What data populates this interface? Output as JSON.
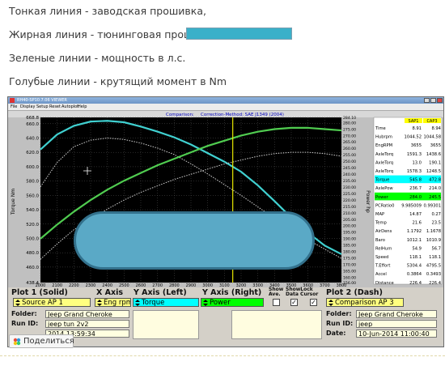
{
  "post": {
    "line1": "Тонкая линия - заводская прошивка,",
    "line2": "Жирная линия - тюнинговая прошивка от",
    "line3": "Зеленые линии - мощность в л.с.",
    "line4": "Голубые линии - крутящий момент в Nm"
  },
  "window": {
    "title": "RH40-SP10.7.06 VIEWER",
    "menu": [
      "File",
      "Display",
      "Setup",
      "Reset",
      "Autoplot",
      "Help"
    ]
  },
  "chart_data": {
    "type": "line",
    "header_left": "Comparison:",
    "header_right": "Correction-Method: SAE J1349 (2004)",
    "ylabel_left": "Torque Nm",
    "ylabel_right": "Power hp",
    "xlim": [
      2000,
      3800
    ],
    "ylim_left": [
      438.4,
      668.8
    ],
    "ylim_right": [
      156.0,
      284.1
    ],
    "x_ticks": [
      "2000",
      "2100",
      "2200",
      "2300",
      "2400",
      "2500",
      "2600",
      "2700",
      "2800",
      "2900",
      "3000",
      "3100",
      "3200",
      "3300",
      "3400",
      "3500",
      "3600",
      "3700",
      "3800"
    ],
    "y_left_ticks": [
      "668.8",
      "660.0",
      "640.0",
      "620.0",
      "600.0",
      "580.0",
      "560.0",
      "540.0",
      "520.0",
      "500.0",
      "480.0",
      "460.0",
      "438.4"
    ],
    "y_right_ticks": [
      "284.10",
      "280.00",
      "275.00",
      "270.00",
      "265.00",
      "260.00",
      "255.00",
      "250.00",
      "245.00",
      "240.00",
      "235.00",
      "230.00",
      "225.00",
      "220.00",
      "215.00",
      "210.00",
      "205.00",
      "200.00",
      "195.00",
      "190.00",
      "185.00",
      "180.00",
      "175.00",
      "170.00",
      "165.00",
      "160.00",
      "156.00"
    ],
    "cursor_x": 3150,
    "series": [
      {
        "axis": "left",
        "color": "#40d0d0",
        "width": 2.2,
        "x": [
          2000,
          2100,
          2200,
          2300,
          2400,
          2500,
          2600,
          2700,
          2800,
          2900,
          3000,
          3100,
          3200,
          3300,
          3400,
          3500,
          3600,
          3700,
          3800
        ],
        "y": [
          624,
          645,
          657,
          663,
          664,
          662,
          656,
          649,
          641,
          631,
          619,
          607,
          593,
          574,
          552,
          529,
          508,
          490,
          478
        ]
      },
      {
        "axis": "left",
        "color": "#d0d0d0",
        "width": 1,
        "x": [
          2000,
          2100,
          2200,
          2300,
          2400,
          2500,
          2600,
          2700,
          2800,
          2900,
          3000,
          3100,
          3200,
          3300,
          3400,
          3500,
          3600,
          3700,
          3800
        ],
        "y": [
          572,
          606,
          628,
          637,
          640,
          638,
          633,
          626,
          617,
          604,
          590,
          575,
          560,
          544,
          528,
          513,
          498,
          485,
          472
        ]
      },
      {
        "axis": "right",
        "color": "#50cc50",
        "width": 2.2,
        "x": [
          2000,
          2100,
          2200,
          2300,
          2400,
          2500,
          2600,
          2700,
          2800,
          2900,
          3000,
          3100,
          3200,
          3300,
          3400,
          3500,
          3600,
          3700,
          3800
        ],
        "y": [
          190,
          201,
          211,
          220,
          228,
          235,
          241,
          247,
          252,
          257,
          262,
          266,
          270,
          273,
          275,
          276,
          276,
          275,
          274
        ]
      },
      {
        "axis": "right",
        "color": "#d0d0d0",
        "width": 1,
        "x": [
          2000,
          2100,
          2200,
          2300,
          2400,
          2500,
          2600,
          2700,
          2800,
          2900,
          3000,
          3100,
          3200,
          3300,
          3400,
          3500,
          3600,
          3700,
          3800
        ],
        "y": [
          174,
          186,
          197,
          205,
          213,
          220,
          226,
          231,
          236,
          240,
          244,
          248,
          251,
          254,
          256,
          257,
          257,
          256,
          254
        ]
      }
    ],
    "table": {
      "headers": [
        "SAP1",
        "CAP3"
      ],
      "rows": [
        {
          "label": "Time",
          "a": "8.91",
          "b": "8.94",
          "hl": ""
        },
        {
          "label": "Hubrpm",
          "a": "1044.52",
          "b": "1044.58",
          "hl": ""
        },
        {
          "label": "EngRPM",
          "a": "3655",
          "b": "3655",
          "hl": ""
        },
        {
          "label": "AxleTorq",
          "a": "1591.3",
          "b": "1438.6",
          "hl": ""
        },
        {
          "label": "AxleTorq",
          "a": "13.0",
          "b": "190.1",
          "hl": ""
        },
        {
          "label": "AxleTorq",
          "a": "1578.3",
          "b": "1248.5",
          "hl": ""
        },
        {
          "label": "Torque",
          "a": "545.8",
          "b": "472.8",
          "hl": "cyan"
        },
        {
          "label": "AxlePow",
          "a": "236.7",
          "b": "214.0",
          "hl": ""
        },
        {
          "label": "Power",
          "a": "284.0",
          "b": "245.5",
          "hl": "green"
        },
        {
          "label": "PCRatio0",
          "a": "9.985009",
          "b": "0.99301",
          "hl": ""
        },
        {
          "label": "MAP",
          "a": "14.87",
          "b": "0.27",
          "hl": ""
        },
        {
          "label": "Temp",
          "a": "21.6",
          "b": "23.5",
          "hl": ""
        },
        {
          "label": "AirDens",
          "a": "1.1792",
          "b": "1.1678",
          "hl": ""
        },
        {
          "label": "Baro",
          "a": "1012.1",
          "b": "1010.9",
          "hl": ""
        },
        {
          "label": "RelHum",
          "a": "54.9",
          "b": "56.7",
          "hl": ""
        },
        {
          "label": "Speed",
          "a": "118.1",
          "b": "118.1",
          "hl": ""
        },
        {
          "label": "T.Effort",
          "a": "5304.4",
          "b": "4795.5",
          "hl": ""
        },
        {
          "label": "Accel",
          "a": "0.3864",
          "b": "0.3493",
          "hl": ""
        },
        {
          "label": "Distance",
          "a": "226.4",
          "b": "226.4",
          "hl": ""
        }
      ]
    }
  },
  "panel": {
    "plot1_label": "Plot 1 (Solid)",
    "xaxis_label": "X Axis",
    "yaxis_left_label": "Y Axis (Left)",
    "yaxis_right_label": "Y Axis (Right)",
    "show_ave_label": "Show Ave.",
    "show_lock_label": "ShowLock Data Cursor",
    "plot2_label": "Plot 2 (Dash)",
    "source1": "Source AP 1",
    "xaxis_value": "Eng rpm",
    "yaxis_left_value": "Torque",
    "yaxis_right_value": "Power",
    "source2": "Comparison AP 3",
    "folder_label": "Folder:",
    "runid_label": "Run ID:",
    "date_label": "Date:",
    "folder1": "Jeep Grand Cheroke",
    "runid1": "jeep tun 2v2",
    "date1": "2014  13:59:34",
    "folder2": "Jeep Grand Cheroke",
    "runid2": "jeep",
    "date2": "10-Jun-2014  11:00:40",
    "check_mark": "✓"
  },
  "share": {
    "label": "Поделиться"
  },
  "colors": {
    "chart_bg": "#000000",
    "torque_line": "#40d0d0",
    "power_line": "#50cc50",
    "factory_line": "#d0d0d0",
    "cursor_line": "#e8e800",
    "pill_fill": "#5aa9c6",
    "redact_fill": "#3ab0c9"
  }
}
